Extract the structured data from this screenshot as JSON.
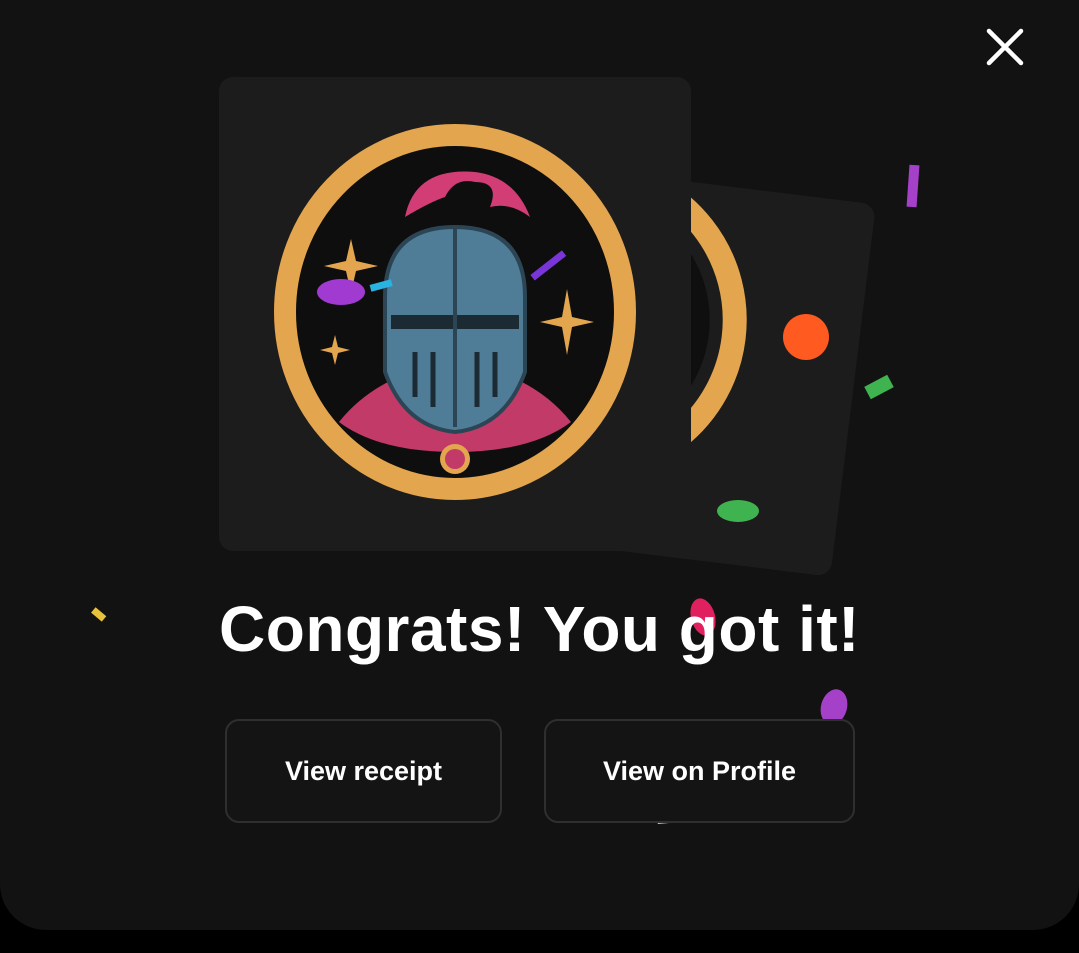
{
  "dialog": {
    "headline": "Congrats! You got it!",
    "close_icon": "close-icon",
    "collectible_image": "knight-helmet-badge",
    "buttons": {
      "receipt_label": "View receipt",
      "profile_label": "View on Profile"
    }
  },
  "colors": {
    "modal_background": "#121212",
    "card_background": "#1c1c1c",
    "button_border": "#2f2f2f",
    "ring": "#e3a54e",
    "plume": "#d23d76",
    "helmet": "#4f7c97"
  }
}
